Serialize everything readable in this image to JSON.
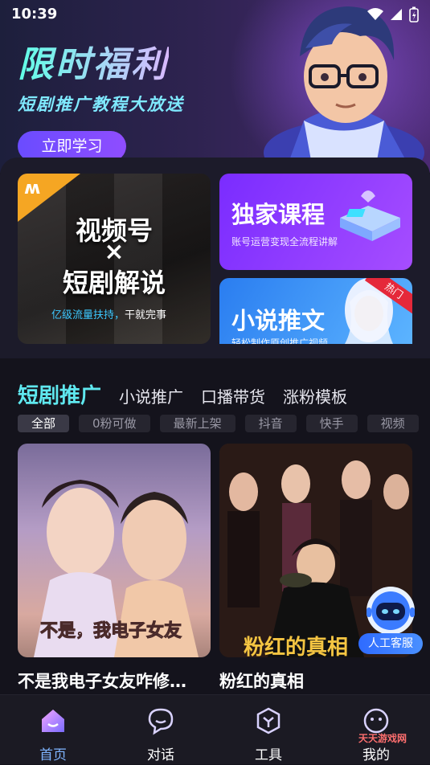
{
  "status_bar": {
    "time": "10:39"
  },
  "banner": {
    "title": "限时福利",
    "subtitle": "短剧推广教程大放送",
    "button_label": "立即学习"
  },
  "feature_cards": {
    "video": {
      "line1": "视频号",
      "line2": "×",
      "line3": "短剧解说",
      "tagline_highlight": "亿级流量扶持，",
      "tagline_rest": "干就完事"
    },
    "course": {
      "title": "独家课程",
      "subtitle": "账号运营变现全流程讲解"
    },
    "novel": {
      "title": "小说推文",
      "subtitle": "轻松制作原创推广视频",
      "badge": "热门"
    }
  },
  "category_tabs": [
    {
      "label": "短剧推广",
      "active": true
    },
    {
      "label": "小说推广",
      "active": false
    },
    {
      "label": "口播带货",
      "active": false
    },
    {
      "label": "涨粉模板",
      "active": false
    }
  ],
  "filter_chips": [
    {
      "label": "全部",
      "active": true
    },
    {
      "label": "0粉可做",
      "active": false
    },
    {
      "label": "最新上架",
      "active": false
    },
    {
      "label": "抖音",
      "active": false
    },
    {
      "label": "快手",
      "active": false
    },
    {
      "label": "视频",
      "active": false
    }
  ],
  "dramas": [
    {
      "title": "不是我电子女友咋修…",
      "poster_text": "不是，我电子女友"
    },
    {
      "title": "粉红的真相",
      "poster_text": "粉红的真相"
    }
  ],
  "customer_service": {
    "label": "人工客服"
  },
  "bottom_nav": [
    {
      "label": "首页",
      "icon": "home-icon",
      "active": true
    },
    {
      "label": "对话",
      "icon": "chat-icon",
      "active": false
    },
    {
      "label": "工具",
      "icon": "tools-icon",
      "active": false
    },
    {
      "label": "我的",
      "icon": "profile-icon",
      "active": false
    }
  ],
  "watermark": "天天游戏网",
  "colors": {
    "accent_cyan": "#5fe8ef",
    "purple_card": "#8a3cff",
    "blue_card": "#3b8cf5",
    "hot_red": "#e5283a",
    "nav_active": "#7fb4ff"
  }
}
